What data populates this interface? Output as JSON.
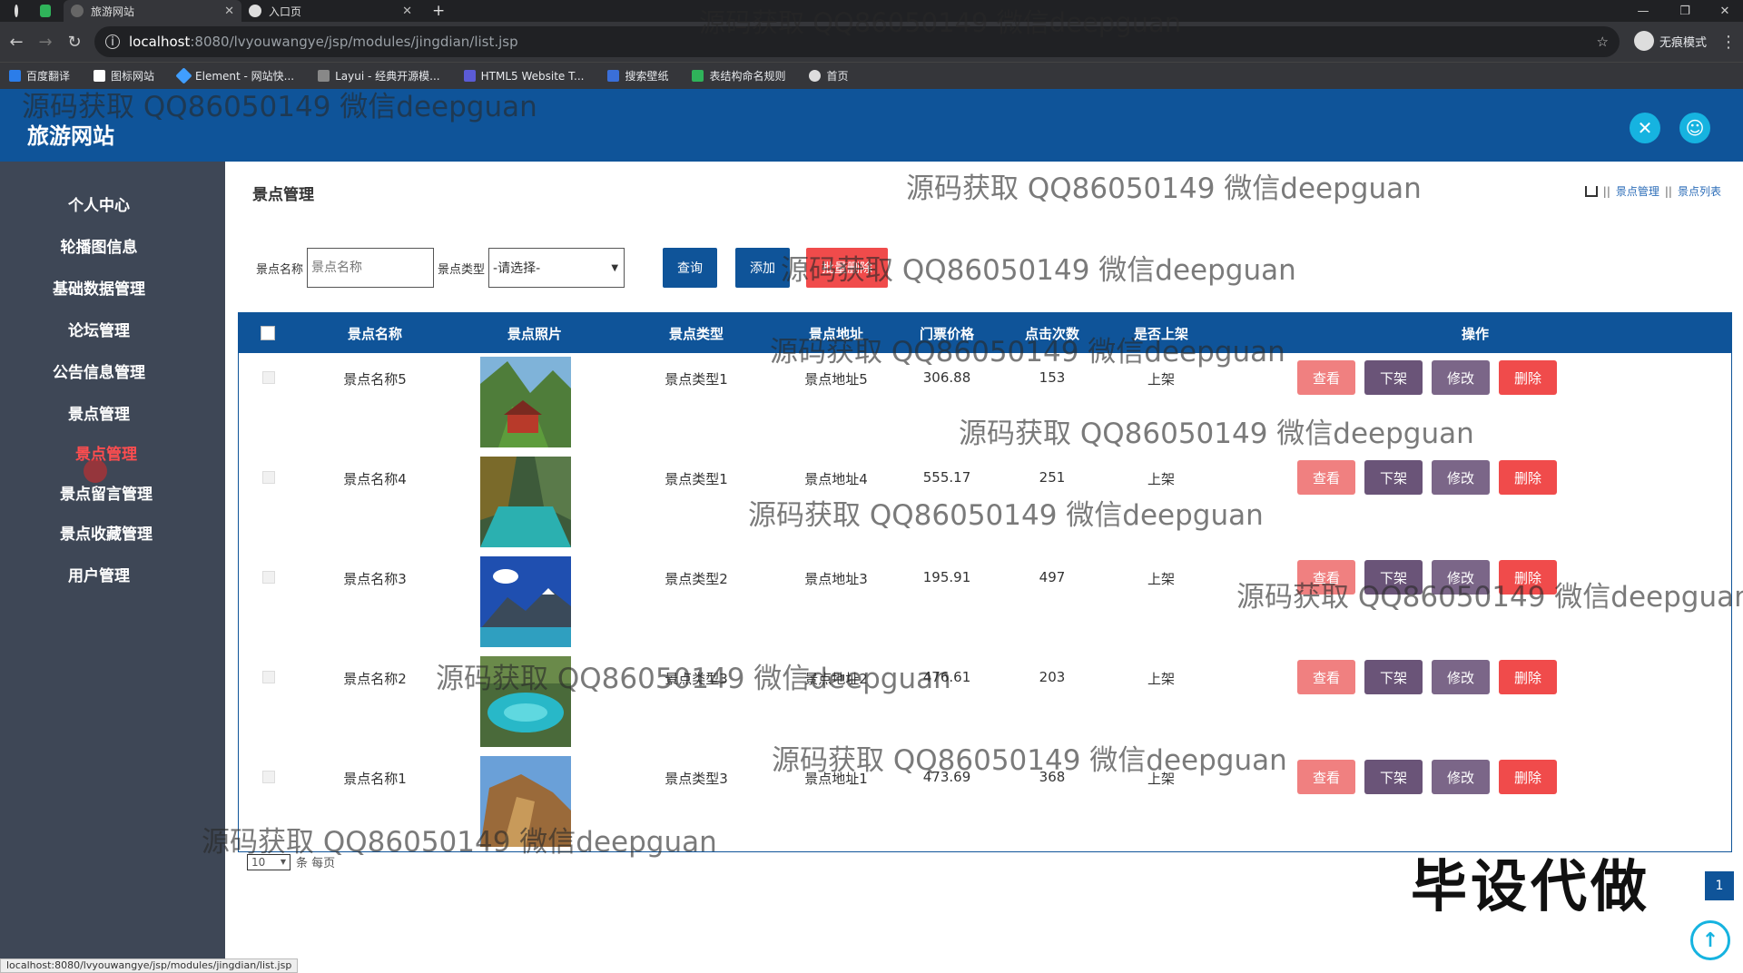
{
  "browser": {
    "tabs": [
      {
        "title": "旅游网站",
        "active": true
      },
      {
        "title": "入口页",
        "active": false
      }
    ],
    "url_host": "localhost",
    "url_path": ":8080/lvyouwangye/jsp/modules/jingdian/list.jsp",
    "incognito_label": "无痕模式",
    "bookmarks": [
      "百度翻译",
      "图标网站",
      "Element - 网站快...",
      "Layui - 经典开源模...",
      "HTML5 Website T...",
      "搜索壁纸",
      "表结构命名规则",
      "首页"
    ],
    "status_url": "localhost:8080/lvyouwangye/jsp/modules/jingdian/list.jsp"
  },
  "app": {
    "title": "旅游网站"
  },
  "sidebar": {
    "items": [
      "个人中心",
      "轮播图信息",
      "基础数据管理",
      "论坛管理",
      "公告信息管理",
      "景点管理",
      "景点管理",
      "景点留言管理",
      "景点收藏管理",
      "用户管理"
    ]
  },
  "page": {
    "title": "景点管理",
    "breadcrumb": [
      "景点管理",
      "景点列表"
    ]
  },
  "search": {
    "name_label": "景点名称",
    "name_placeholder": "景点名称",
    "type_label": "景点类型",
    "type_selected": "-请选择-",
    "query_button": "查询",
    "add_button": "添加",
    "delete_button": "批量删除"
  },
  "table": {
    "headers": [
      "景点名称",
      "景点照片",
      "景点类型",
      "景点地址",
      "门票价格",
      "点击次数",
      "是否上架",
      "操作"
    ],
    "rows": [
      {
        "name": "景点名称5",
        "type": "景点类型1",
        "address": "景点地址5",
        "price": "306.88",
        "clicks": "153",
        "status": "上架"
      },
      {
        "name": "景点名称4",
        "type": "景点类型1",
        "address": "景点地址4",
        "price": "555.17",
        "clicks": "251",
        "status": "上架"
      },
      {
        "name": "景点名称3",
        "type": "景点类型2",
        "address": "景点地址3",
        "price": "195.91",
        "clicks": "497",
        "status": "上架"
      },
      {
        "name": "景点名称2",
        "type": "景点类型3",
        "address": "景点地址2",
        "price": "476.61",
        "clicks": "203",
        "status": "上架"
      },
      {
        "name": "景点名称1",
        "type": "景点类型3",
        "address": "景点地址1",
        "price": "473.69",
        "clicks": "368",
        "status": "上架"
      }
    ],
    "actions": {
      "view": "查看",
      "offshelf": "下架",
      "edit": "修改",
      "delete": "删除"
    }
  },
  "pager": {
    "page_size": "10",
    "per_page_label": "条 每页",
    "current_page": "1"
  },
  "promo": "毕设代做",
  "watermark": "源码获取 QQ86050149 微信deepguan",
  "colors": {
    "header": "#0f5499",
    "sidebar": "#3e4756",
    "accent": "#16b3e0",
    "view": "#f08080",
    "offshelf": "#6a5478",
    "edit": "#7b6688",
    "delete": "#f04b4b"
  }
}
